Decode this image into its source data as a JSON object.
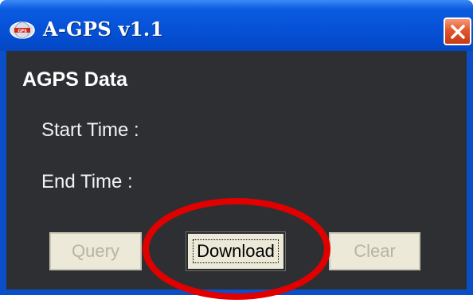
{
  "window": {
    "title": "A-GPS v1.1",
    "close_icon": "close-icon",
    "app_icon": "agps-globe-icon"
  },
  "main": {
    "section_title": "AGPS Data",
    "start_time_label": "Start Time :",
    "end_time_label": "End Time :"
  },
  "buttons": {
    "query_label": "Query",
    "download_label": "Download",
    "clear_label": "Clear"
  },
  "colors": {
    "titlebar": "#0551d6",
    "client_bg": "#2d2f33",
    "highlight_ring": "#e10000"
  }
}
